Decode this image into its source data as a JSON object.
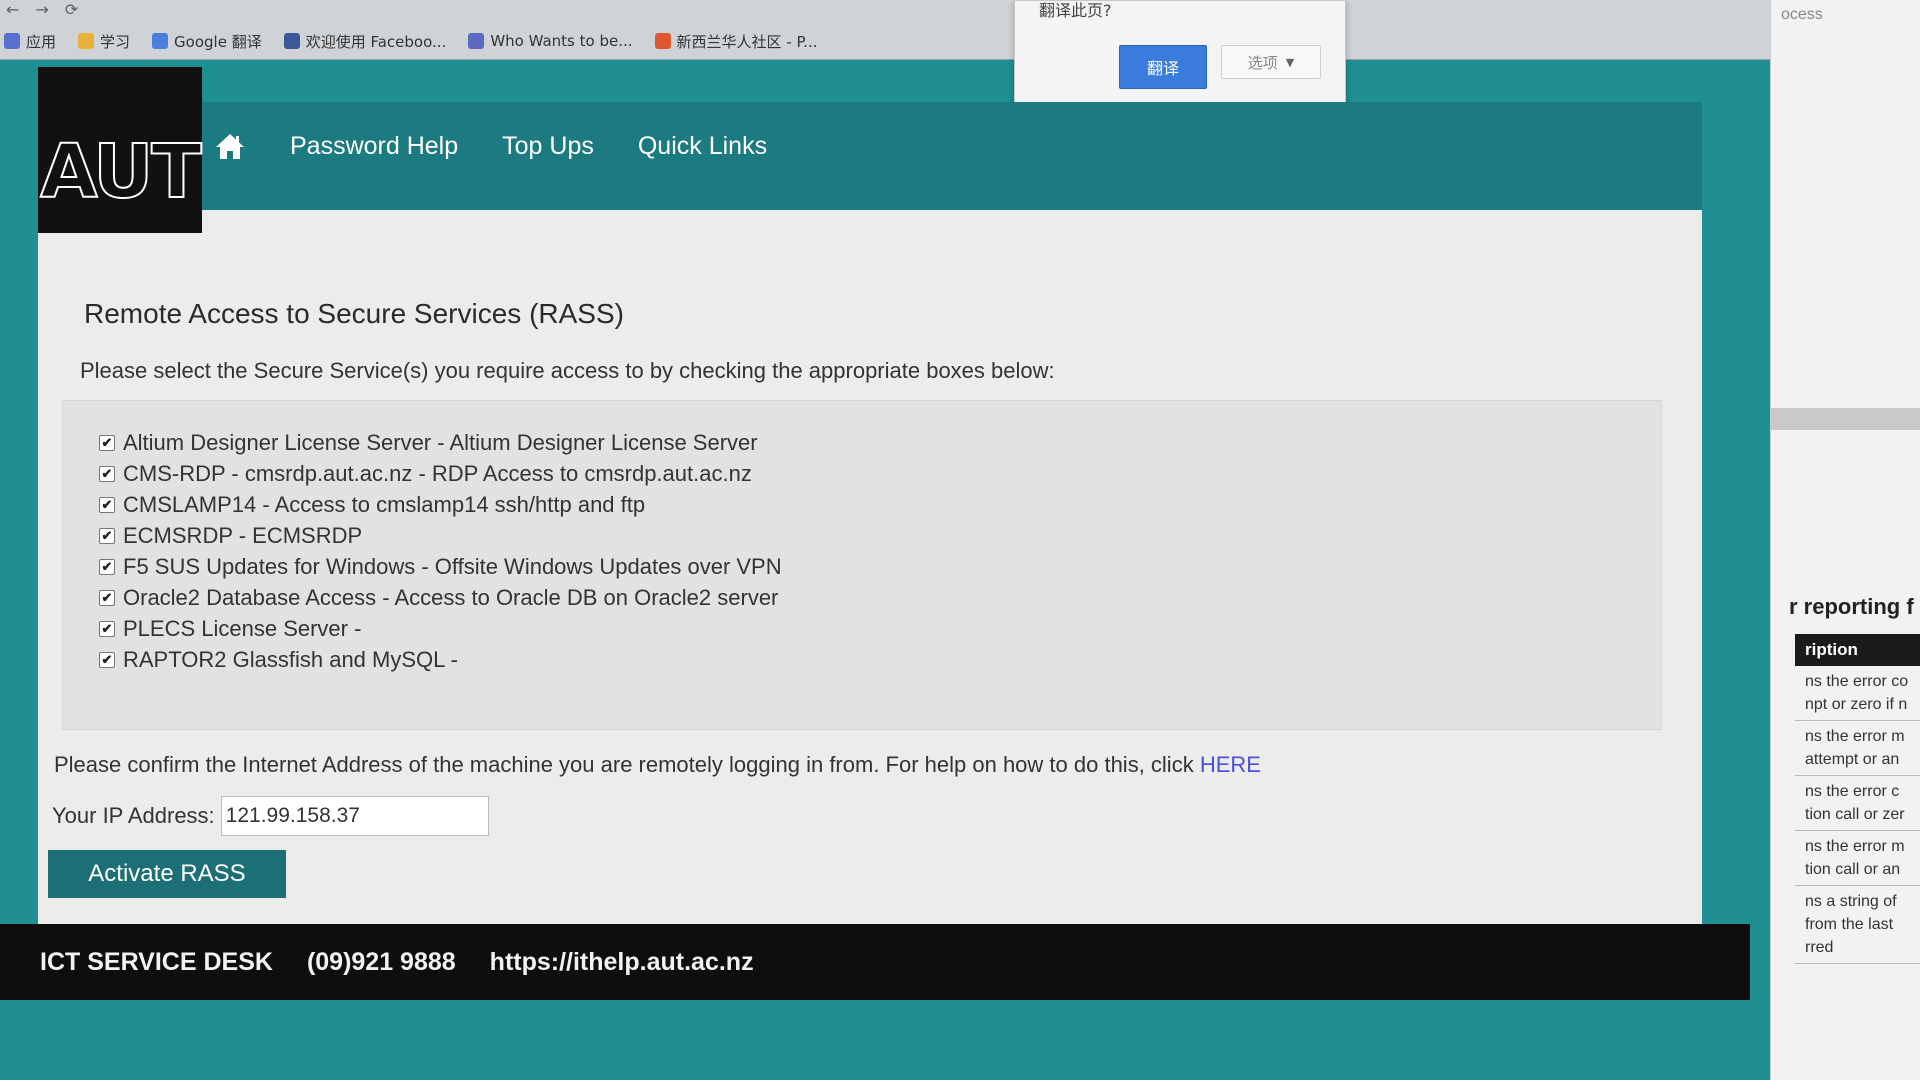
{
  "browser": {
    "nav_glyphs": [
      "←",
      "→",
      "⟳"
    ],
    "bookmarks": [
      {
        "label": "应用",
        "icon": "apps-grid-icon",
        "color": "#5a6ecf"
      },
      {
        "label": "学习",
        "icon": "folder-icon",
        "color": "#e8b23a"
      },
      {
        "label": "Google 翻译",
        "icon": "google-translate-icon",
        "color": "#4a7fe0"
      },
      {
        "label": "欢迎使用 Faceboo...",
        "icon": "facebook-icon",
        "color": "#3b5998"
      },
      {
        "label": "Who Wants to be...",
        "icon": "page-icon",
        "color": "#5c6bc0"
      },
      {
        "label": "新西兰华人社区 - P...",
        "icon": "community-icon",
        "color": "#e0582f"
      }
    ]
  },
  "translate_popup": {
    "question": "翻译此页?",
    "translate_label": "翻译",
    "options_label": "选项"
  },
  "header": {
    "logo_text": "AUT",
    "nav": [
      "Password Help",
      "Top Ups",
      "Quick Links"
    ]
  },
  "main": {
    "title": "Remote Access to Secure Services (RASS)",
    "instruction": "Please select the Secure Service(s) you require access to by checking the appropriate boxes below:",
    "services": [
      {
        "label": "Altium Designer License Server - Altium Designer License Server",
        "checked": true
      },
      {
        "label": "CMS-RDP - cmsrdp.aut.ac.nz - RDP Access to cmsrdp.aut.ac.nz",
        "checked": true
      },
      {
        "label": "CMSLAMP14 - Access to cmslamp14 ssh/http and ftp",
        "checked": true
      },
      {
        "label": "ECMSRDP - ECMSRDP",
        "checked": true
      },
      {
        "label": "F5 SUS Updates for Windows - Offsite Windows Updates over VPN",
        "checked": true
      },
      {
        "label": "Oracle2 Database Access - Access to Oracle DB on Oracle2 server",
        "checked": true
      },
      {
        "label": "PLECS License Server -",
        "checked": true
      },
      {
        "label": "RAPTOR2 Glassfish and MySQL -",
        "checked": true
      }
    ],
    "confirm_text": "Please confirm the Internet Address of the machine you are remotely logging in from. For help on how to do this, click ",
    "here_link": "HERE",
    "ip_label": "Your IP Address:",
    "ip_value": "121.99.158.37",
    "activate_label": "Activate RASS"
  },
  "footer": {
    "desk": "ICT SERVICE DESK",
    "phone": "(09)921 9888",
    "url": "https://ithelp.aut.ac.nz"
  },
  "side_panel": {
    "top_text": "ocess",
    "heading": "r reporting f",
    "column_header": "ription",
    "rows": [
      [
        "ns the error co",
        "npt or zero if n"
      ],
      [
        "ns the error m",
        "attempt or an"
      ],
      [
        "ns the error c",
        "tion call or zer"
      ],
      [
        "ns the error m",
        "tion call or an"
      ],
      [
        "ns a string of",
        "from the last",
        "rred"
      ]
    ]
  },
  "colors": {
    "teal_background": "#1f8f94",
    "header_teal": "#1c7b80",
    "button_teal": "#1c6f74",
    "footer_black": "#0e0e0e",
    "link_blue": "#4d4de0"
  }
}
